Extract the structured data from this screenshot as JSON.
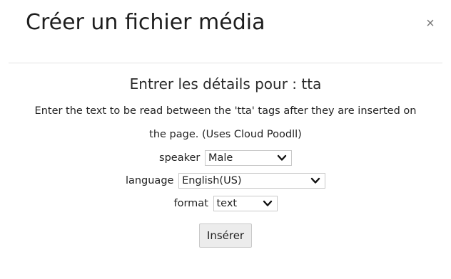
{
  "dialog": {
    "title": "Créer un fichier média",
    "close_label": "×"
  },
  "body": {
    "heading": "Entrer les détails pour : tta",
    "instructions": "Enter the text to be read between the 'tta' tags after they are inserted on the page. (Uses Cloud Poodll)"
  },
  "fields": {
    "speaker": {
      "label": "speaker",
      "value": "Male"
    },
    "language": {
      "label": "language",
      "value": "English(US)"
    },
    "format": {
      "label": "format",
      "value": "text"
    }
  },
  "actions": {
    "insert_label": "Insérer"
  },
  "icons": {
    "close": "close-icon",
    "dropdown": "chevron-down-icon"
  }
}
